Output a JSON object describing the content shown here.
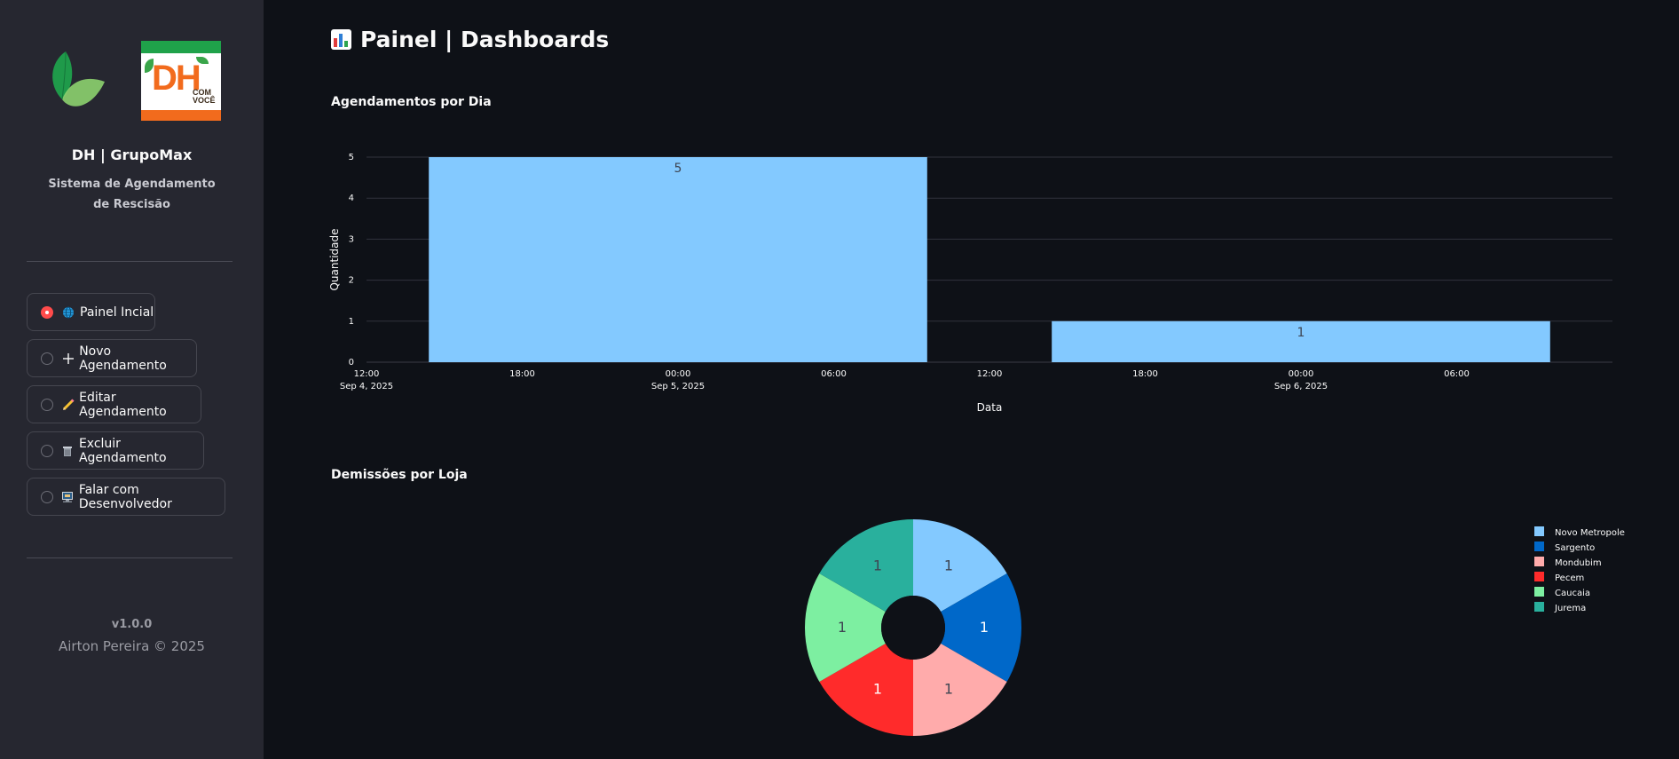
{
  "sidebar": {
    "title": "DH | GrupoMax",
    "subtitle": "Sistema de Agendamento de Rescisão",
    "logo_text": "DH com você",
    "nav": [
      {
        "label": "Painel Incial",
        "icon": "globe-icon",
        "selected": true
      },
      {
        "label": "Novo Agendamento",
        "icon": "plus-icon",
        "selected": false
      },
      {
        "label": "Editar Agendamento",
        "icon": "pencil-icon",
        "selected": false
      },
      {
        "label": "Excluir Agendamento",
        "icon": "trash-icon",
        "selected": false
      },
      {
        "label": "Falar com Desenvolvedor",
        "icon": "computer-icon",
        "selected": false
      }
    ],
    "version": "v1.0.0",
    "copyright": "Airton Pereira © 2025"
  },
  "main": {
    "title": "Painel | Dashboards"
  },
  "colors": {
    "accent": "#ff4b4b",
    "sidebar_bg": "#262730",
    "main_bg": "#0e1117"
  },
  "chart_data": [
    {
      "type": "bar",
      "title": "Agendamentos por Dia",
      "xlabel": "Data",
      "ylabel": "Quantidade",
      "x_type": "date",
      "xlim": [
        "2025-09-04 12:00",
        "2025-09-06 12:00"
      ],
      "ylim": [
        0,
        5
      ],
      "yticks": [
        0,
        1,
        2,
        3,
        4,
        5
      ],
      "xtick_labels": [
        {
          "line1": "12:00",
          "line2": "Sep 4, 2025"
        },
        {
          "line1": "18:00",
          "line2": ""
        },
        {
          "line1": "00:00",
          "line2": "Sep 5, 2025"
        },
        {
          "line1": "06:00",
          "line2": ""
        },
        {
          "line1": "12:00",
          "line2": ""
        },
        {
          "line1": "18:00",
          "line2": ""
        },
        {
          "line1": "00:00",
          "line2": "Sep 6, 2025"
        },
        {
          "line1": "06:00",
          "line2": ""
        }
      ],
      "categories": [
        "2025-09-05",
        "2025-09-06"
      ],
      "values": [
        5,
        1
      ],
      "data_labels": [
        "5",
        "1"
      ],
      "bar_color": "#83c9ff",
      "grid": true
    },
    {
      "type": "pie",
      "title": "Demissões por Loja",
      "hole": true,
      "labels": [
        "Novo Metropole",
        "Sargento",
        "Mondubim",
        "Pecem",
        "Caucaia",
        "Jurema"
      ],
      "values": [
        1,
        1,
        1,
        1,
        1,
        1
      ],
      "data_labels": [
        "1",
        "1",
        "1",
        "1",
        "1",
        "1"
      ],
      "colors": [
        "#83c9ff",
        "#0068c9",
        "#ffabab",
        "#ff2b2b",
        "#7defa1",
        "#29b09d"
      ],
      "legend_position": "right"
    }
  ]
}
